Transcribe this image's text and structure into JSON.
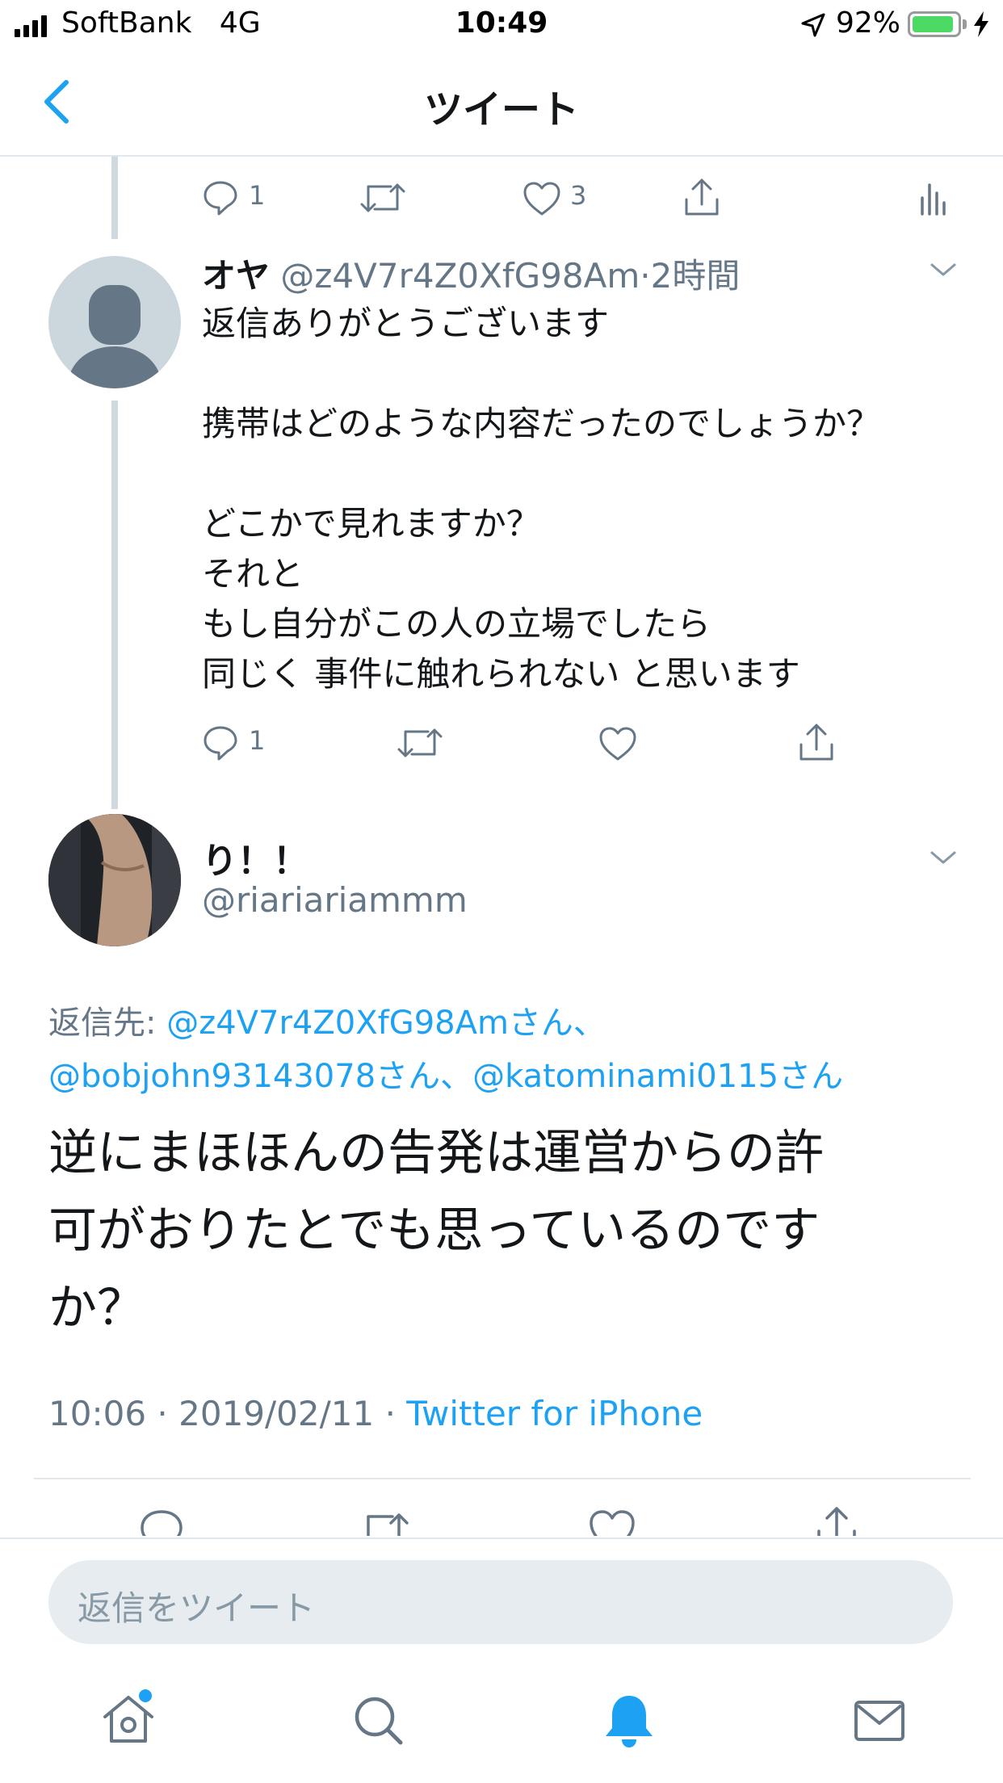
{
  "status_bar": {
    "carrier": "SoftBank",
    "network": "4G",
    "time": "10:49",
    "battery_percent": "92%",
    "battery_level": 0.92
  },
  "nav": {
    "title": "ツイート"
  },
  "prev_tweet_actions": {
    "reply_count": "1",
    "like_count": "3"
  },
  "reply_tweet": {
    "display_name": "オヤ",
    "handle": "@z4V7r4Z0XfG98Am",
    "separator": "·",
    "time_ago": "2時間",
    "text": "返信ありがとうございます\n\n携帯はどのような内容だったのでしょうか？\n\nどこかで見れますか？\nそれと\nもし自分がこの人の立場でしたら\n同じく 事件に触れられない と思います",
    "reply_count": "1"
  },
  "main_tweet": {
    "display_name": "り！！",
    "handle": "@riariariammm",
    "replying_to_label": "返信先:",
    "replying_to_line1": "@z4V7r4Z0XfG98Amさん、",
    "replying_to_line2": "@bobjohn93143078さん、@katominami0115さん",
    "text": "逆にまほほんの告発は運営からの許\n可がおりたとでも思っているのです\nか？",
    "time": "10:06",
    "dot": "·",
    "date": "2019/02/11",
    "source": "Twitter for iPhone"
  },
  "composer": {
    "placeholder": "返信をツイート"
  },
  "colors": {
    "accent": "#1da1f2",
    "muted": "#657786",
    "divider": "#e1e8ed",
    "thread_line": "#cfd9de"
  }
}
